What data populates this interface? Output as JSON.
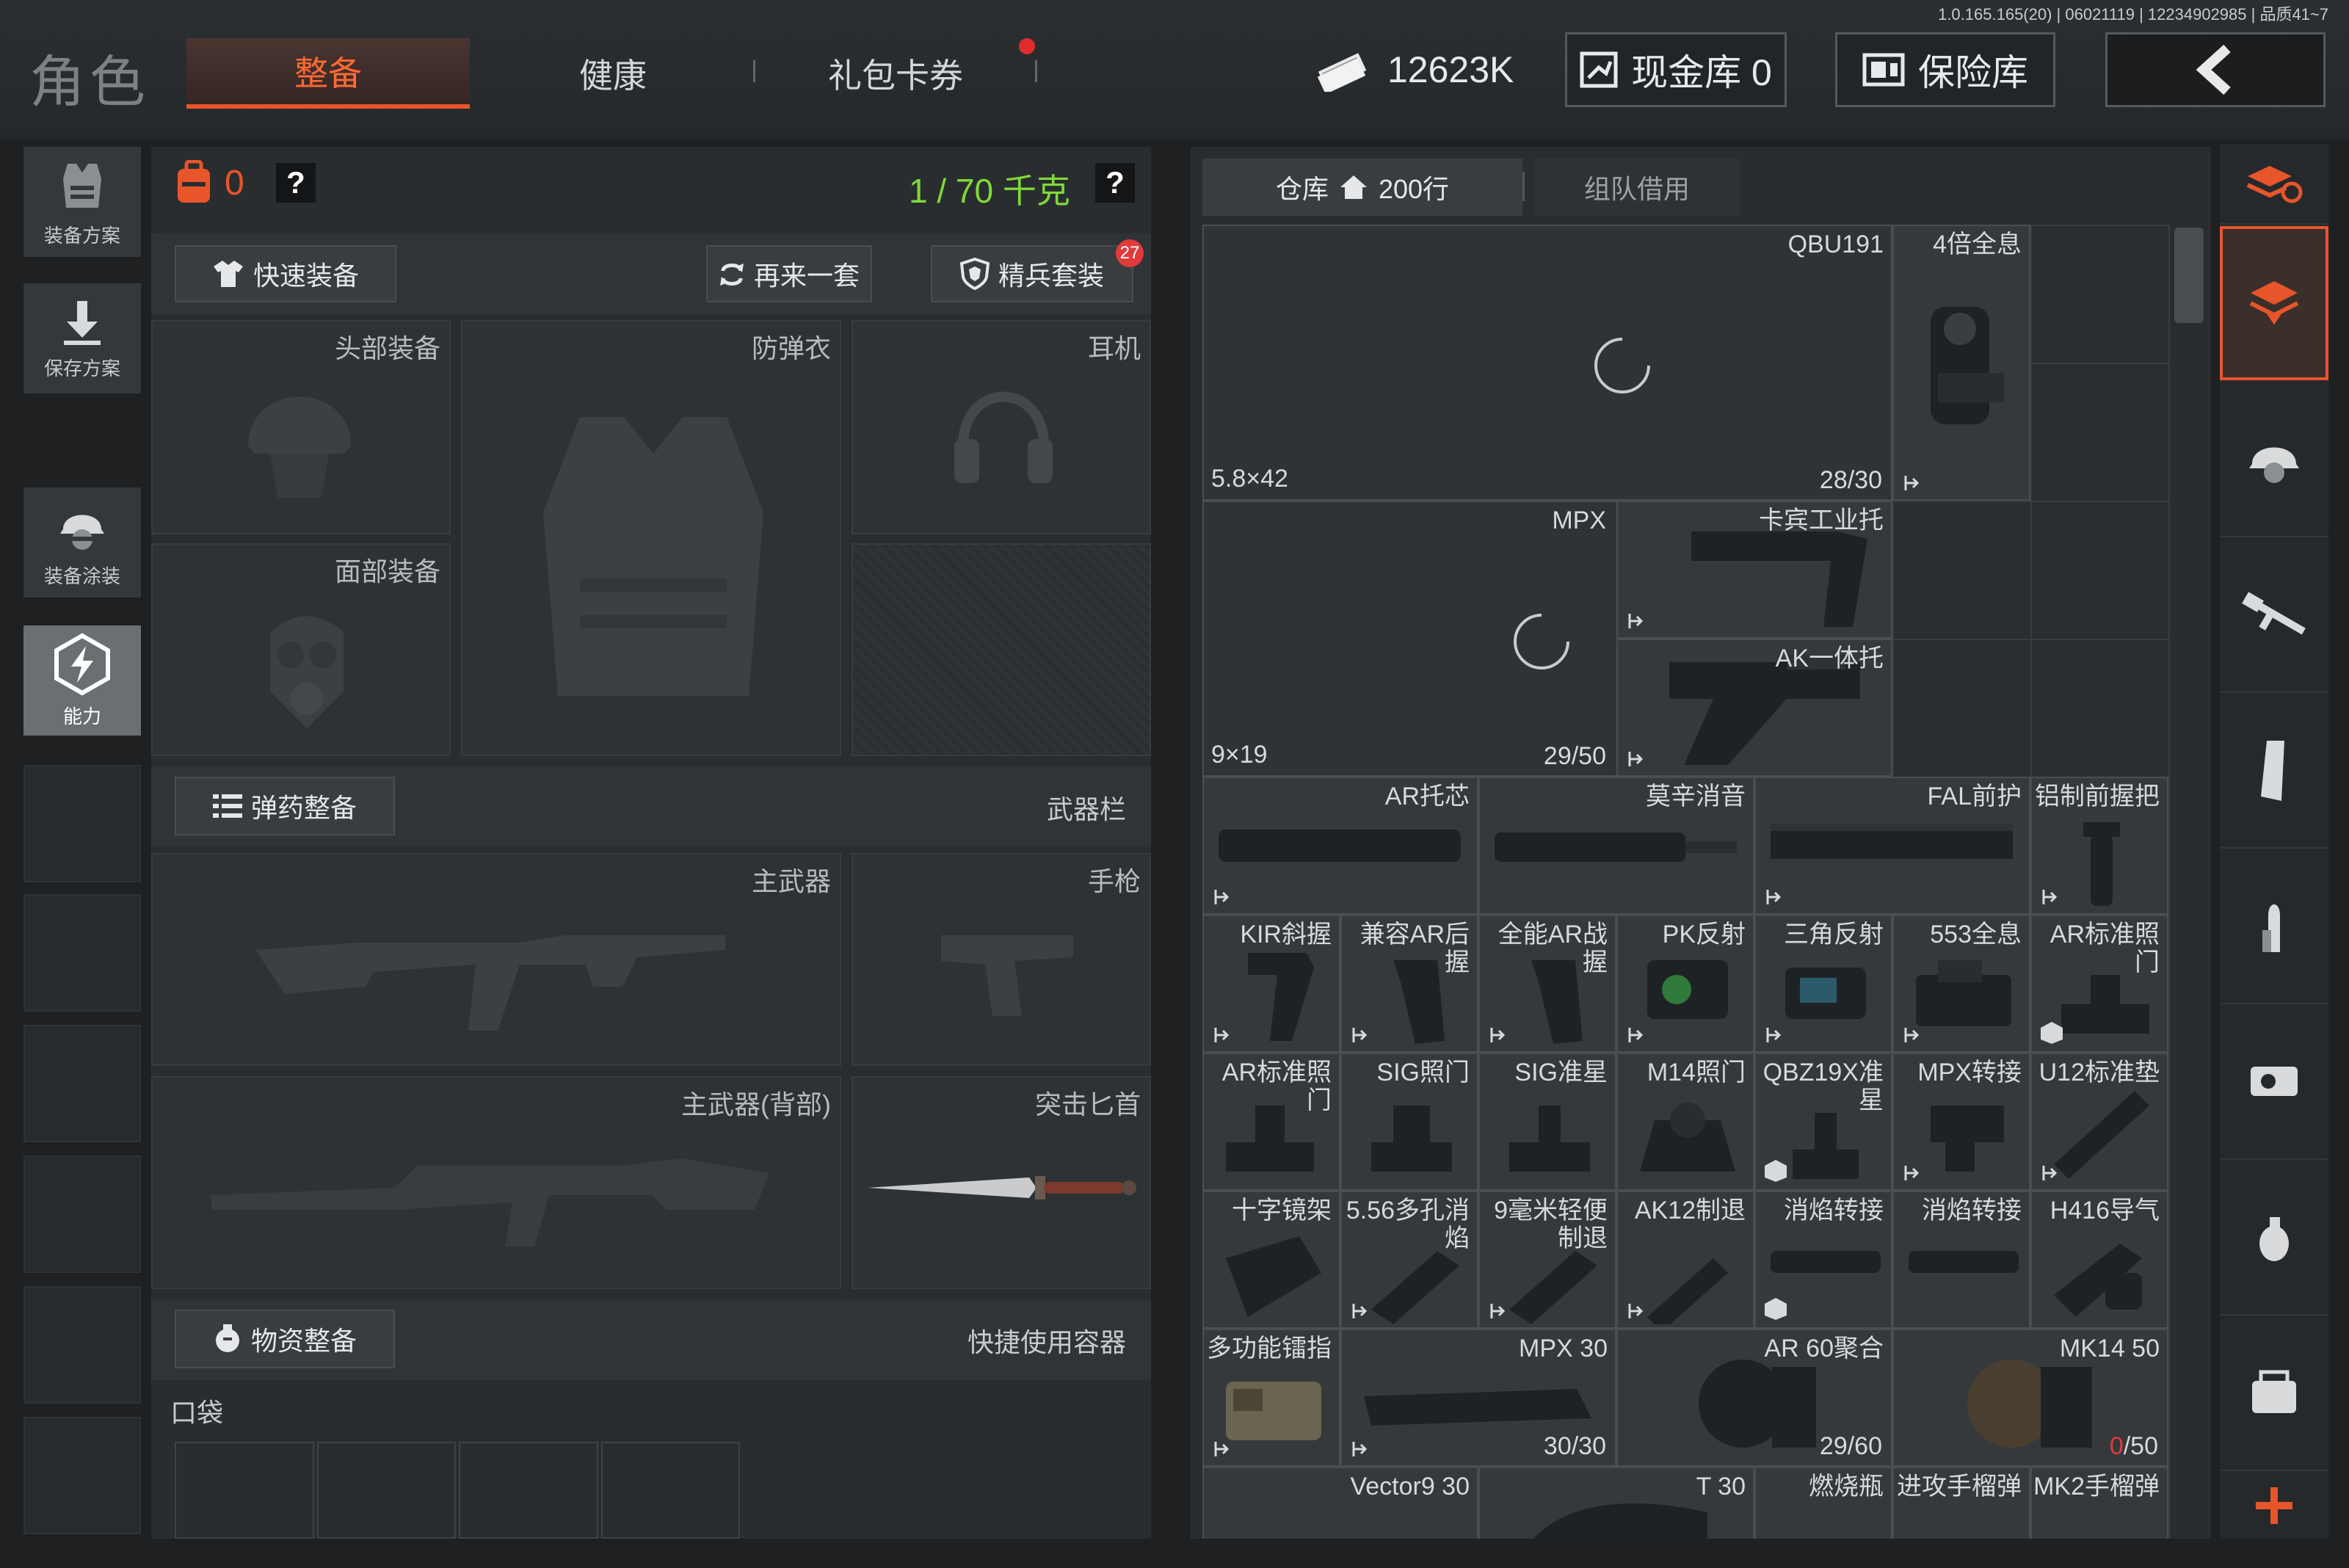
{
  "header": {
    "title": "角色",
    "tabs": [
      {
        "label": "整备",
        "active": true
      },
      {
        "label": "健康",
        "active": false
      },
      {
        "label": "礼包卡券",
        "active": false,
        "badge": "red-dot"
      }
    ],
    "version": "1.0.165.165(20) | 06021119 | 12234902985 | 品质41~7",
    "money": "12623K",
    "cash_vault": "现金库 0",
    "safe": "保险库",
    "back_icon": "chevron-left-icon"
  },
  "left_nav": [
    {
      "label": "装备方案",
      "icon": "vest-icon"
    },
    {
      "label": "保存方案",
      "icon": "download-icon"
    },
    {
      "label": "装备涂装",
      "icon": "helmet-icon"
    },
    {
      "label": "能力",
      "icon": "ability-icon",
      "active": true
    }
  ],
  "equipment": {
    "backpack_count": "0",
    "weight": "1 / 70 千克",
    "help": "?",
    "quick_equip": "快速装备",
    "again": "再来一套",
    "elite": "精兵套装",
    "elite_badge": "27",
    "slots": {
      "head": "头部装备",
      "armor": "防弹衣",
      "earphone": "耳机",
      "face": "面部装备"
    },
    "ammo_btn": "弹药整备",
    "weapon_bar": "武器栏",
    "weapons": {
      "primary": "主武器",
      "pistol": "手枪",
      "primary_back": "主武器(背部)",
      "knife": "突击匕首"
    },
    "supply_btn": "物资整备",
    "quick_container": "快捷使用容器",
    "pocket": "口袋"
  },
  "warehouse": {
    "tab_label": "仓库",
    "tab_count": "200行",
    "team_tab": "组队借用",
    "items": [
      {
        "name": "QBU191",
        "caliber": "5.8×42",
        "count": "28/30"
      },
      {
        "name": "4倍全息"
      },
      {
        "name": "MPX",
        "caliber": "9×19",
        "count": "29/50"
      },
      {
        "name": "卡宾工业托"
      },
      {
        "name": "AK一体托"
      },
      {
        "name": "AR托芯"
      },
      {
        "name": "莫辛消音"
      },
      {
        "name": "FAL前护"
      },
      {
        "name": "铝制前握把"
      },
      {
        "name": "KIR斜握"
      },
      {
        "name": "兼容AR后握"
      },
      {
        "name": "全能AR战握"
      },
      {
        "name": "PK反射"
      },
      {
        "name": "三角反射"
      },
      {
        "name": "553全息"
      },
      {
        "name": "AR标准照门"
      },
      {
        "name": "AR标准照门"
      },
      {
        "name": "SIG照门"
      },
      {
        "name": "SIG准星"
      },
      {
        "name": "M14照门"
      },
      {
        "name": "QBZ19X准星"
      },
      {
        "name": "MPX转接"
      },
      {
        "name": "U12标准垫"
      },
      {
        "name": "十字镜架"
      },
      {
        "name": "5.56多孔消焰"
      },
      {
        "name": "9毫米轻便制退"
      },
      {
        "name": "AK12制退"
      },
      {
        "name": "消焰转接"
      },
      {
        "name": "消焰转接"
      },
      {
        "name": "H416导气"
      },
      {
        "name": "多功能镭指"
      },
      {
        "name": "MPX 30",
        "count": "30/30"
      },
      {
        "name": "AR 60聚合",
        "count": "29/60"
      },
      {
        "name": "MK14 50",
        "count_red": "0",
        "count_rest": "/50"
      },
      {
        "name": "Vector9 30"
      },
      {
        "name": "T 30"
      },
      {
        "name": "燃烧瓶"
      },
      {
        "name": "进攻手榴弹"
      },
      {
        "name": "MK2手榴弹"
      }
    ]
  },
  "right_side": [
    "layers-refresh-icon",
    "layers-down-icon",
    "helmet-icon",
    "rifle-icon",
    "magazine-icon",
    "bullet-icon",
    "sight-icon",
    "grenade-icon",
    "container-icon",
    "plus-icon"
  ],
  "colors": {
    "accent": "#e8552a",
    "weight": "#7fd93a",
    "count_red": "#e23a3a"
  }
}
